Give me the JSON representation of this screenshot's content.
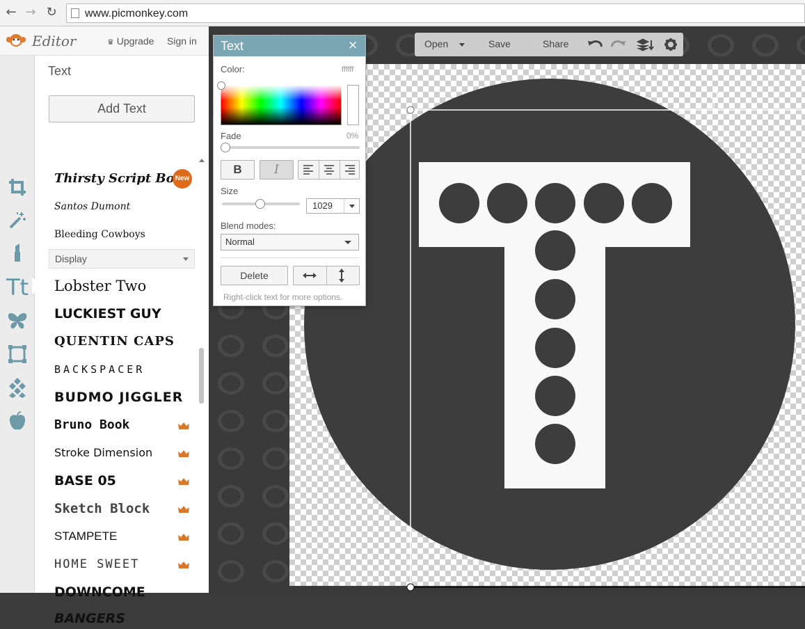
{
  "browser": {
    "url": "www.picmonkey.com",
    "back_icon": "arrow-left-icon",
    "forward_icon": "arrow-right-icon",
    "reload_icon": "reload-icon"
  },
  "header": {
    "app_name": "Editor",
    "upgrade": "Upgrade",
    "sign_in": "Sign in"
  },
  "panel": {
    "title": "Text",
    "add_text": "Add Text",
    "category": "Display",
    "new_badge": "New",
    "fonts": [
      {
        "name": "Thirsty Script Bold",
        "premium": false
      },
      {
        "name": "Santos Dumont",
        "premium": false
      },
      {
        "name": "Bleeding Cowboys",
        "premium": false
      },
      {
        "name": "Lobster Two",
        "premium": false
      },
      {
        "name": "LUCKIEST GUY",
        "premium": false
      },
      {
        "name": "QUENTIN CAPS",
        "premium": false
      },
      {
        "name": "BACKSPACER",
        "premium": false
      },
      {
        "name": "BUDMO JIGGLER",
        "premium": false
      },
      {
        "name": "Bruno Book",
        "premium": true
      },
      {
        "name": "Stroke Dimension",
        "premium": true
      },
      {
        "name": "BASE 05",
        "premium": true
      },
      {
        "name": "Sketch Block",
        "premium": true
      },
      {
        "name": "STAMPETE",
        "premium": true
      },
      {
        "name": "HOME SWEET",
        "premium": true
      },
      {
        "name": "DOWNCOME",
        "premium": false
      },
      {
        "name": "BANGERS",
        "premium": false
      }
    ]
  },
  "toolbar": {
    "open": "Open",
    "save": "Save",
    "share": "Share"
  },
  "dialog": {
    "title": "Text",
    "close": "×",
    "color_label": "Color:",
    "color_value": "ffffff",
    "fade_label": "Fade",
    "fade_value": "0%",
    "bold": "B",
    "italic": "I",
    "size_label": "Size",
    "size_value": "1029",
    "blend_label": "Blend modes:",
    "blend_value": "Normal",
    "delete": "Delete",
    "hint": "Right-click text for more options."
  },
  "colors": {
    "accent": "#7aa6b3",
    "badge": "#e06a1b",
    "crown": "#d9772b",
    "canvas_shape": "#3d3d3d",
    "letter": "#f8f8f8"
  }
}
